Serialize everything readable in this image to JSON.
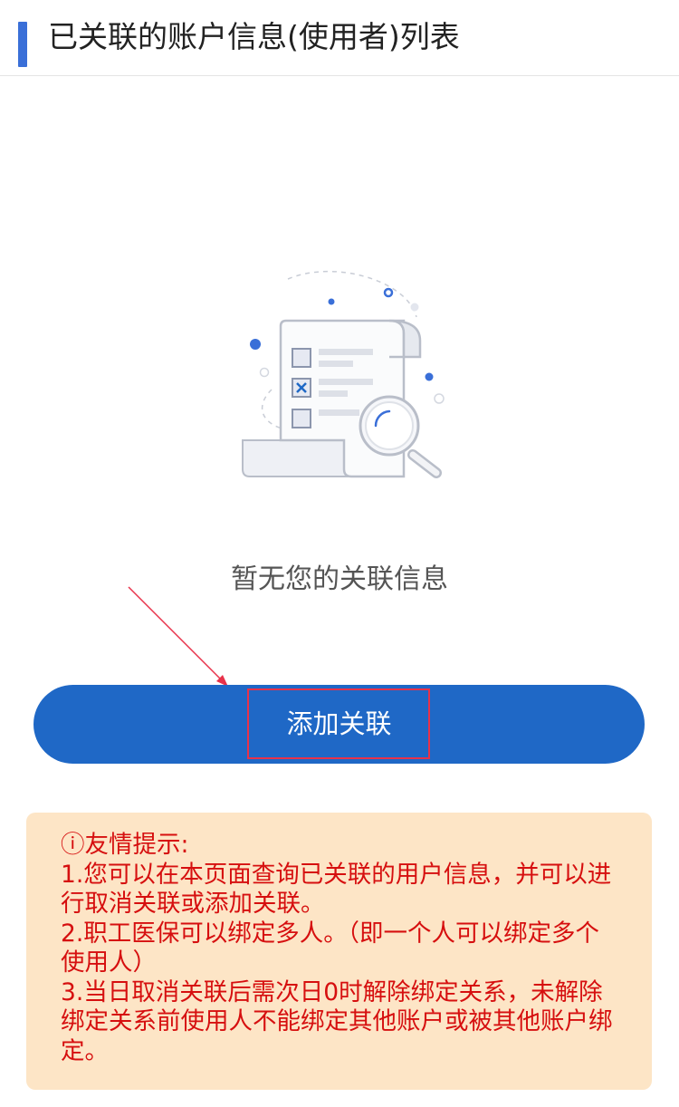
{
  "header": {
    "title": "已关联的账户信息(使用者)列表"
  },
  "empty_state": {
    "illustration": "document-checklist-magnifier-icon",
    "message": "暂无您的关联信息"
  },
  "actions": {
    "add_label": "添加关联"
  },
  "tips": {
    "heading": "ⓘ友情提示:",
    "items": [
      "1.您可以在本页面查询已关联的用户信息，并可以进行取消关联或添加关联。",
      "2.职工医保可以绑定多人。（即一个人可以绑定多个使用人）",
      "3.当日取消关联后需次日0时解除绑定关系，未解除绑定关系前使用人不能绑定其他账户或被其他账户绑定。"
    ]
  },
  "colors": {
    "accent": "#3a6fd8",
    "button": "#1f68c6",
    "tips_background": "#fde5c6",
    "tips_text": "#d60f0f",
    "annotation": "#e8324a"
  }
}
